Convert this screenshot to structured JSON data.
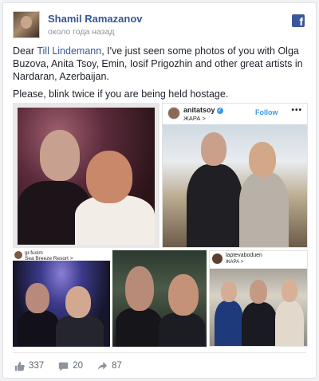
{
  "post": {
    "author": "Shamil Ramazanov",
    "timestamp": "около года назад",
    "text_before_link": "Dear ",
    "mention": "Till Lindemann",
    "text_after_link": ", I've just seen some photos of you with Olga Buzova, Anita Tsoy, Emin, Iosif Prigozhin and other great artists in Nardaran, Azerbaijan.",
    "paragraph2": "Please, blink twice if you are being held hostage."
  },
  "brand": {
    "logo": "f",
    "color": "#3b5998"
  },
  "gallery": {
    "photo2": {
      "username": "anitatsoy",
      "verified_mark": "✓",
      "location": "ЖАРА >",
      "follow_label": "Follow",
      "more": "•••"
    },
    "photo3": {
      "username": "gr.fuslm",
      "location": "Sea Breeze Resort >"
    },
    "photo5": {
      "username": "laptevaboduen",
      "location": "ЖАРА >"
    }
  },
  "actions": {
    "likes": "337",
    "comments": "20",
    "shares": "87"
  },
  "icons": [
    "facebook-logo-icon",
    "like-icon",
    "comment-icon",
    "share-icon",
    "verified-icon",
    "more-icon"
  ]
}
